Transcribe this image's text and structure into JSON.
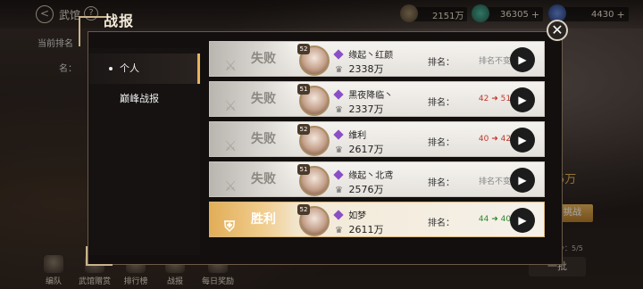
{
  "header": {
    "title": "武馆",
    "help": "?",
    "resources": [
      {
        "name": "resource-1",
        "value": "2151万",
        "plus": false,
        "color": "#6b5a44"
      },
      {
        "name": "resource-2",
        "value": "36305",
        "plus": true,
        "color": "#2e7d6a"
      },
      {
        "name": "resource-3",
        "value": "4430",
        "plus": true,
        "color": "#3a55a0"
      }
    ]
  },
  "background": {
    "current_rank_label": "当前排名",
    "rank_label_short": "名：",
    "right_amount": "5万",
    "challenge_label": "挑战",
    "count_label": "今：5/5",
    "batch_label": "一批"
  },
  "bottom_nav": [
    {
      "label": "编队"
    },
    {
      "label": "武馆赠赏"
    },
    {
      "label": "排行榜"
    },
    {
      "label": "战报"
    },
    {
      "label": "每日奖励"
    }
  ],
  "modal": {
    "title": "战报",
    "close": "✕",
    "tabs": [
      {
        "label": "个人",
        "active": true
      },
      {
        "label": "巅峰战报",
        "active": false
      }
    ],
    "rank_label": "排名：",
    "rows": [
      {
        "result": "失败",
        "win": false,
        "level": "52",
        "name": "缘起丶红颜",
        "power": "2338万",
        "rank_from": "排名不变",
        "rank_to": "",
        "rank_type": "same"
      },
      {
        "result": "失败",
        "win": false,
        "level": "51",
        "name": "黑夜降临丶",
        "power": "2337万",
        "rank_from": "42",
        "rank_to": "51",
        "rank_type": "down"
      },
      {
        "result": "失败",
        "win": false,
        "level": "52",
        "name": "维利",
        "power": "2617万",
        "rank_from": "40",
        "rank_to": "42",
        "rank_type": "down"
      },
      {
        "result": "失败",
        "win": false,
        "level": "51",
        "name": "缘起丶北鸢",
        "power": "2576万",
        "rank_from": "排名不变",
        "rank_to": "",
        "rank_type": "same"
      },
      {
        "result": "胜利",
        "win": true,
        "level": "52",
        "name": "如梦",
        "power": "2611万",
        "rank_from": "44",
        "rank_to": "40",
        "rank_type": "up"
      }
    ]
  }
}
